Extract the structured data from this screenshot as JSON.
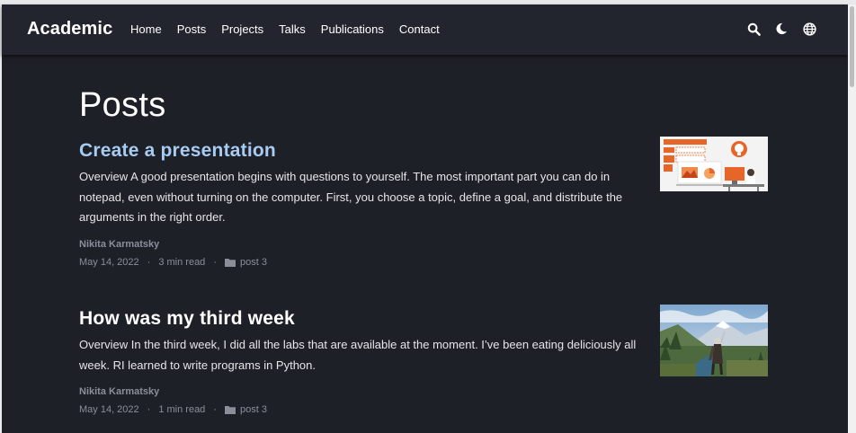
{
  "navbar": {
    "brand": "Academic",
    "links": [
      "Home",
      "Posts",
      "Projects",
      "Talks",
      "Publications",
      "Contact"
    ],
    "icons": [
      "search-icon",
      "moon-icon",
      "globe-icon"
    ]
  },
  "page": {
    "title": "Posts"
  },
  "posts": [
    {
      "title": "Create a presentation",
      "summary": "Overview A good presentation begins with questions to yourself. The most important part you can do in notepad, even without turning on the computer. First, you choose a topic, define a goal, and distribute the arguments in the right order.",
      "author": "Nikita Karmatsky",
      "date": "May 14, 2022",
      "read_time": "3 min read",
      "category": "post 3",
      "separator": "·"
    },
    {
      "title": "How was my third week",
      "summary": "Overview In the third week, I did all the labs that are available at the moment. I’ve been eating deliciously all week. RI learned to write programs in Python.",
      "author": "Nikita Karmatsky",
      "date": "May 14, 2022",
      "read_time": "1 min read",
      "category": "post 3",
      "separator": "·"
    }
  ],
  "colors": {
    "background": "#1e2028",
    "navbar": "#23252e",
    "link_title": "#a7cbf1",
    "meta": "#8b8e98"
  }
}
